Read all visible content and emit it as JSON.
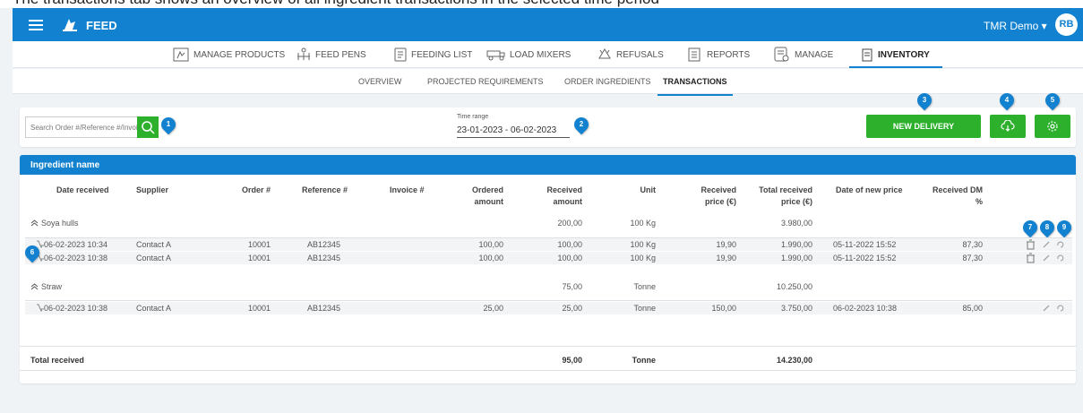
{
  "app": {
    "title": "FEED",
    "user_menu": "TMR Demo ▾",
    "avatar_initials": "RB"
  },
  "caption_text": "The transactions tab shows an overview of all ingredient transactions in the selected time period",
  "main_nav": [
    {
      "label": "MANAGE PRODUCTS",
      "icon": "manage-products-icon"
    },
    {
      "label": "FEED PENS",
      "icon": "feed-pens-icon"
    },
    {
      "label": "FEEDING LIST",
      "icon": "feeding-list-icon"
    },
    {
      "label": "LOAD MIXERS",
      "icon": "load-mixers-icon"
    },
    {
      "label": "REFUSALS",
      "icon": "refusals-icon"
    },
    {
      "label": "REPORTS",
      "icon": "reports-icon"
    },
    {
      "label": "MANAGE",
      "icon": "manage-icon"
    },
    {
      "label": "INVENTORY",
      "icon": "inventory-icon",
      "active": true
    }
  ],
  "sub_nav": [
    {
      "label": "OVERVIEW"
    },
    {
      "label": "PROJECTED REQUIREMENTS"
    },
    {
      "label": "ORDER INGREDIENTS"
    },
    {
      "label": "TRANSACTIONS",
      "active": true
    }
  ],
  "filter": {
    "search_placeholder": "Search Order #/Reference #/Invoice #",
    "time_range_label": "Time range",
    "time_range_value": "23-01-2023 - 06-02-2023",
    "new_delivery_label": "NEW DELIVERY"
  },
  "markers": [
    "1",
    "2",
    "3",
    "4",
    "5",
    "6",
    "7",
    "8",
    "9"
  ],
  "table": {
    "group_header": "Ingredient name",
    "columns": {
      "date_received": "Date received",
      "supplier": "Supplier",
      "order": "Order #",
      "reference": "Reference #",
      "invoice": "Invoice #",
      "ordered_1": "Ordered",
      "ordered_2": "amount",
      "received_1": "Received",
      "received_2": "amount",
      "unit": "Unit",
      "price_1": "Received",
      "price_2": "price (€)",
      "total_1": "Total received",
      "total_2": "price (€)",
      "new_price": "Date of new price",
      "dm_1": "Received DM",
      "dm_2": "%"
    },
    "groups": [
      {
        "name": "Soya hulls",
        "received_amount": "200,00",
        "unit": "100 Kg",
        "total_price": "3.980,00",
        "rows": [
          {
            "date": "06-02-2023 10:34",
            "supplier": "Contact A",
            "order": "10001",
            "reference": "AB12345",
            "invoice": "",
            "ordered": "100,00",
            "received": "100,00",
            "unit": "100 Kg",
            "price": "19,90",
            "total": "1.990,00",
            "new_price_date": "05-11-2022 15:52",
            "dm": "87,30"
          },
          {
            "date": "06-02-2023 10:38",
            "supplier": "Contact A",
            "order": "10001",
            "reference": "AB12345",
            "invoice": "",
            "ordered": "100,00",
            "received": "100,00",
            "unit": "100 Kg",
            "price": "19,90",
            "total": "1.990,00",
            "new_price_date": "05-11-2022 15:52",
            "dm": "87,30"
          }
        ]
      },
      {
        "name": "Straw",
        "received_amount": "75,00",
        "unit": "Tonne",
        "total_price": "10.250,00",
        "rows": [
          {
            "date": "06-02-2023 10:38",
            "supplier": "Contact A",
            "order": "10001",
            "reference": "AB12345",
            "invoice": "",
            "ordered": "25,00",
            "received": "25,00",
            "unit": "Tonne",
            "price": "150,00",
            "total": "3.750,00",
            "new_price_date": "06-02-2023 10:38",
            "dm": "85,00"
          }
        ]
      }
    ],
    "total": {
      "label": "Total received",
      "received_amount": "95,00",
      "unit": "Tonne",
      "total_price": "14.230,00"
    }
  },
  "colors": {
    "primary": "#1282d0",
    "green": "#2db12d",
    "background": "#f0f3f6"
  }
}
